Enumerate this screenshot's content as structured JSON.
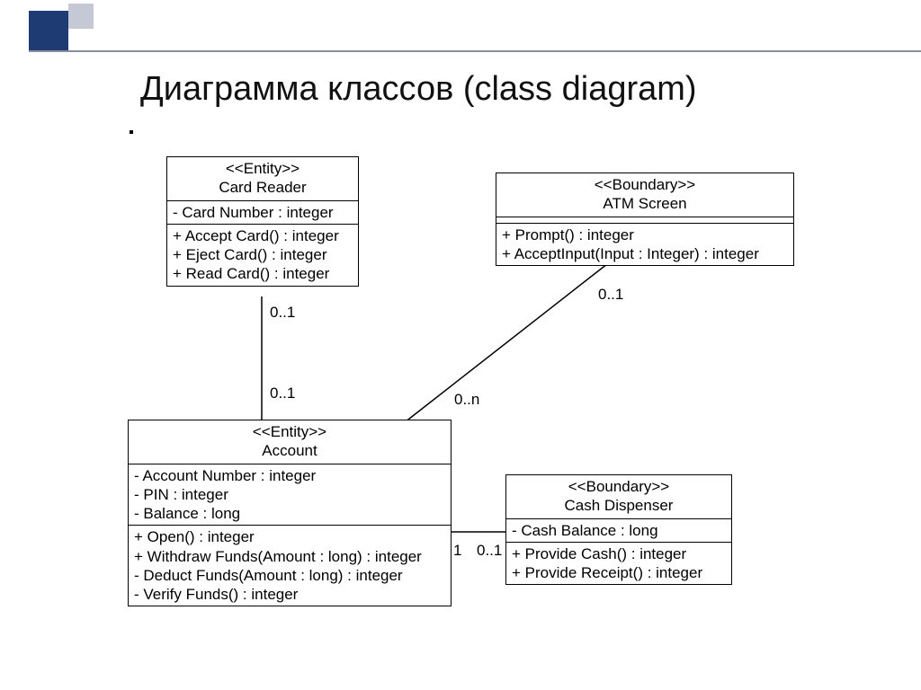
{
  "title": "Диаграмма классов (class diagram)",
  "classes": {
    "cardReader": {
      "stereotype": "<<Entity>>",
      "name": "Card Reader",
      "attrs": [
        "- Card Number : integer"
      ],
      "ops": [
        "+ Accept Card() : integer",
        "+ Eject Card() : integer",
        "+ Read Card() : integer"
      ]
    },
    "atmScreen": {
      "stereotype": "<<Boundary>>",
      "name": "ATM Screen",
      "attrs_empty": true,
      "ops": [
        "+ Prompt() : integer",
        "+ AcceptInput(Input : Integer) : integer"
      ]
    },
    "account": {
      "stereotype": "<<Entity>>",
      "name": "Account",
      "attrs": [
        "- Account Number : integer",
        "- PIN : integer",
        "- Balance : long"
      ],
      "ops": [
        "+ Open() : integer",
        "+ Withdraw Funds(Amount : long) : integer",
        "- Deduct Funds(Amount : long) : integer",
        "- Verify Funds() : integer"
      ]
    },
    "cashDispenser": {
      "stereotype": "<<Boundary>>",
      "name": "Cash Dispenser",
      "attrs": [
        "- Cash Balance : long"
      ],
      "ops": [
        "+ Provide Cash() : integer",
        "+ Provide Receipt() : integer"
      ]
    }
  },
  "multiplicities": {
    "cr_near": "0..1",
    "cr_far": "0..1",
    "atm_near": "0..1",
    "atm_far": "0..n",
    "cd_near": "1",
    "cd_far": "0..1"
  }
}
